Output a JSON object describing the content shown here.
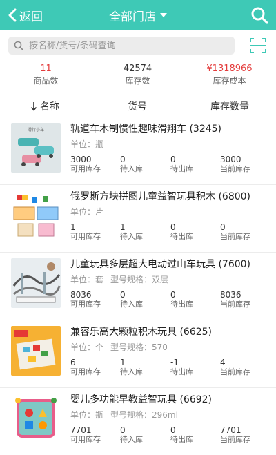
{
  "header": {
    "back_label": "返回",
    "title": "全部门店",
    "bg_color": "#3ec9b6"
  },
  "search": {
    "placeholder": "按名称/货号/条码查询",
    "value": ""
  },
  "stats": {
    "product_count": "11",
    "product_count_label": "商品数",
    "stock_count": "42574",
    "stock_count_label": "库存数",
    "stock_cost": "¥1318966",
    "stock_cost_label": "库存成本"
  },
  "columns": {
    "name": "名称",
    "sku": "货号",
    "qty": "库存数量"
  },
  "labels": {
    "available": "可用库存",
    "incoming": "待入库",
    "outgoing": "待出库",
    "current": "当前库存"
  },
  "items": [
    {
      "name": "轨道车木制惯性趣味滑翔车 (3245)",
      "unit": "单位：瓶",
      "spec": "",
      "available": "3000",
      "incoming": "0",
      "outgoing": "0",
      "current": "3000",
      "thumb_caption": "滑行小车",
      "thumb_color": "#dfe6e8"
    },
    {
      "name": "俄罗斯方块拼图儿童益智玩具积木 (6800)",
      "unit": "单位：片",
      "spec": "",
      "available": "1",
      "incoming": "1",
      "outgoing": "0",
      "current": "0",
      "thumb_color": "#ffffff"
    },
    {
      "name": "儿童玩具多层超大电动过山车玩具 (7600)",
      "unit": "单位：套",
      "spec": "型号规格：双层",
      "available": "8036",
      "incoming": "0",
      "outgoing": "0",
      "current": "8036",
      "thumb_color": "#e8edf0"
    },
    {
      "name": "兼容乐高大颗粒积木玩具 (6625)",
      "unit": "单位：个",
      "spec": "型号规格：570",
      "available": "6",
      "incoming": "1",
      "outgoing": "-1",
      "current": "4",
      "thumb_color": "#f6b133"
    },
    {
      "name": "婴儿多功能早教益智玩具 (6692)",
      "unit": "单位：瓶",
      "spec": "型号规格：296ml",
      "available": "7701",
      "incoming": "0",
      "outgoing": "0",
      "current": "7701",
      "thumb_color": "#ffffff"
    }
  ]
}
